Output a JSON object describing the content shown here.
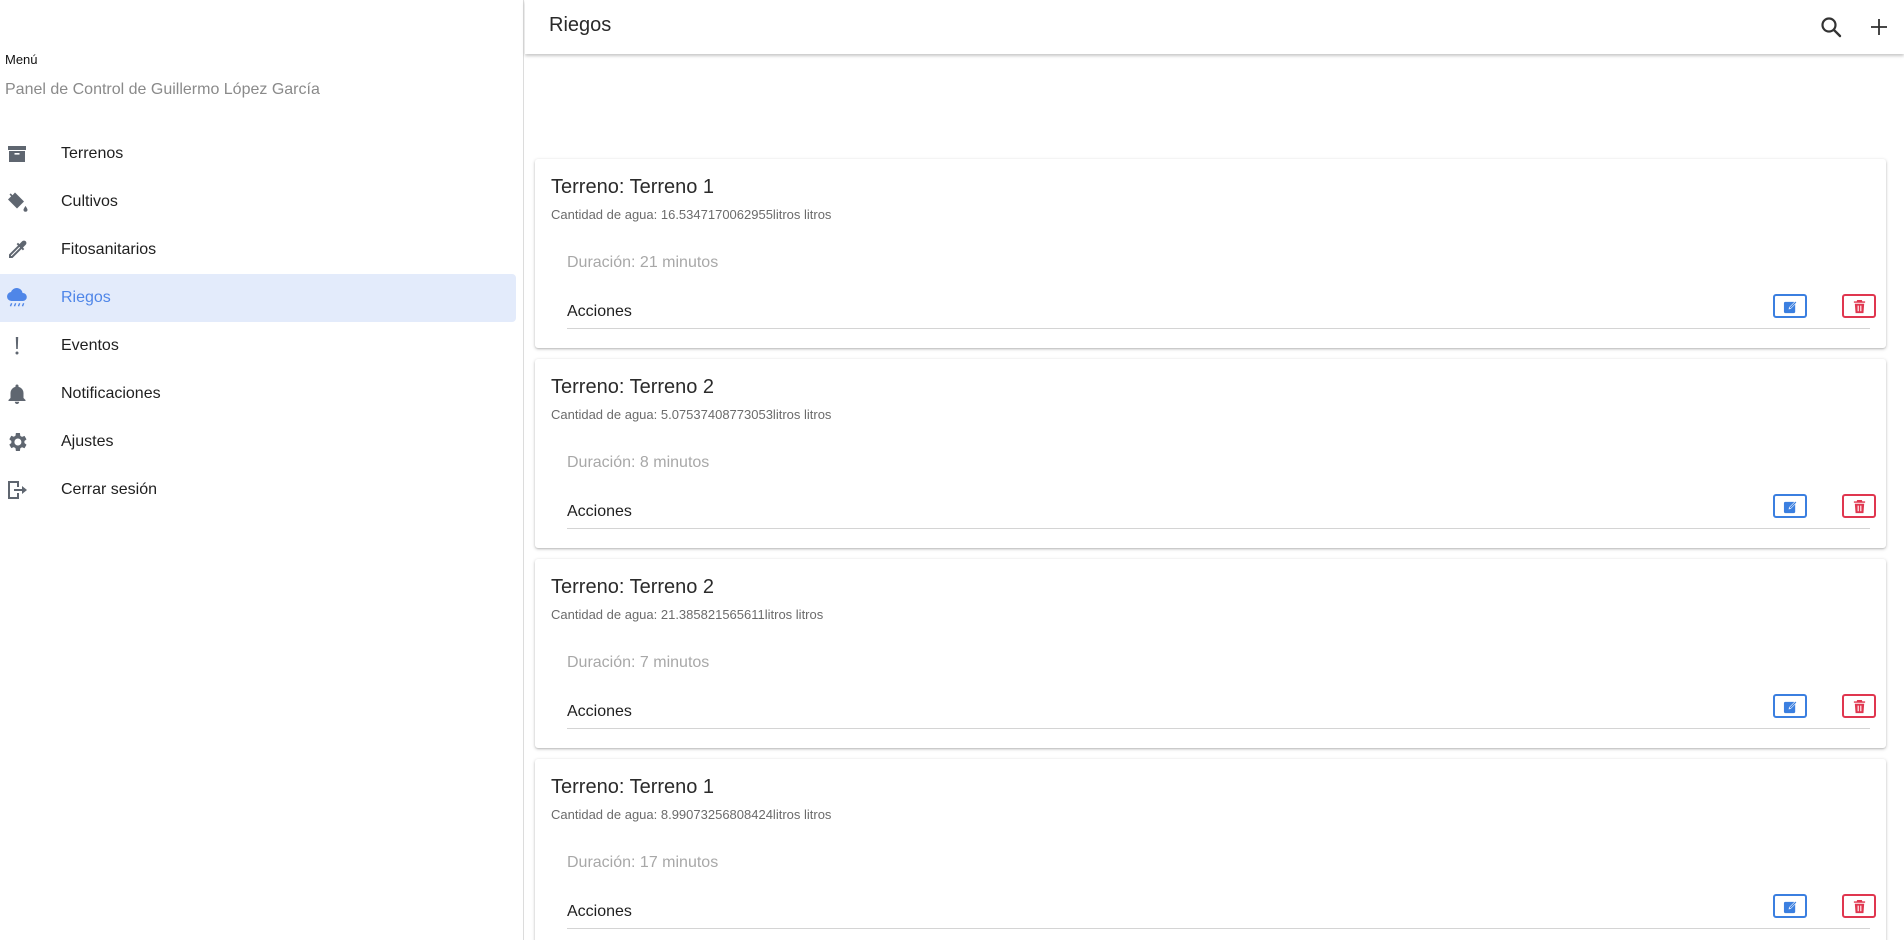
{
  "sidebar": {
    "menu_label": "Menú",
    "subtitle": "Panel de Control de Guillermo López García",
    "items": [
      {
        "label": "Terrenos",
        "icon": "archive-icon",
        "active": false
      },
      {
        "label": "Cultivos",
        "icon": "paint-bucket-icon",
        "active": false
      },
      {
        "label": "Fitosanitarios",
        "icon": "eyedropper-icon",
        "active": false
      },
      {
        "label": "Riegos",
        "icon": "rain-cloud-icon",
        "active": true
      },
      {
        "label": "Eventos",
        "icon": "exclamation-icon",
        "active": false
      },
      {
        "label": "Notificaciones",
        "icon": "bell-icon",
        "active": false
      },
      {
        "label": "Ajustes",
        "icon": "gear-icon",
        "active": false
      },
      {
        "label": "Cerrar sesión",
        "icon": "logout-icon",
        "active": false
      }
    ]
  },
  "header": {
    "title": "Riegos",
    "search_icon": "search-icon",
    "add_icon": "plus-icon"
  },
  "cards": [
    {
      "title": "Terreno: Terreno 1",
      "water": "Cantidad de agua: 16.5347170062955litros litros",
      "duration": "Duración: 21 minutos",
      "actions_label": "Acciones"
    },
    {
      "title": "Terreno: Terreno 2",
      "water": "Cantidad de agua: 5.07537408773053litros litros",
      "duration": "Duración: 8 minutos",
      "actions_label": "Acciones"
    },
    {
      "title": "Terreno: Terreno 2",
      "water": "Cantidad de agua: 21.385821565611litros litros",
      "duration": "Duración: 7 minutos",
      "actions_label": "Acciones"
    },
    {
      "title": "Terreno: Terreno 1",
      "water": "Cantidad de agua: 8.99073256808424litros litros",
      "duration": "Duración: 17 minutos",
      "actions_label": "Acciones"
    }
  ],
  "colors": {
    "accent": "#4f86e8",
    "active_bg": "#e3ebfb",
    "edit": "#3b7fe0",
    "delete": "#e0364f",
    "icon_gray": "#5f6670"
  }
}
